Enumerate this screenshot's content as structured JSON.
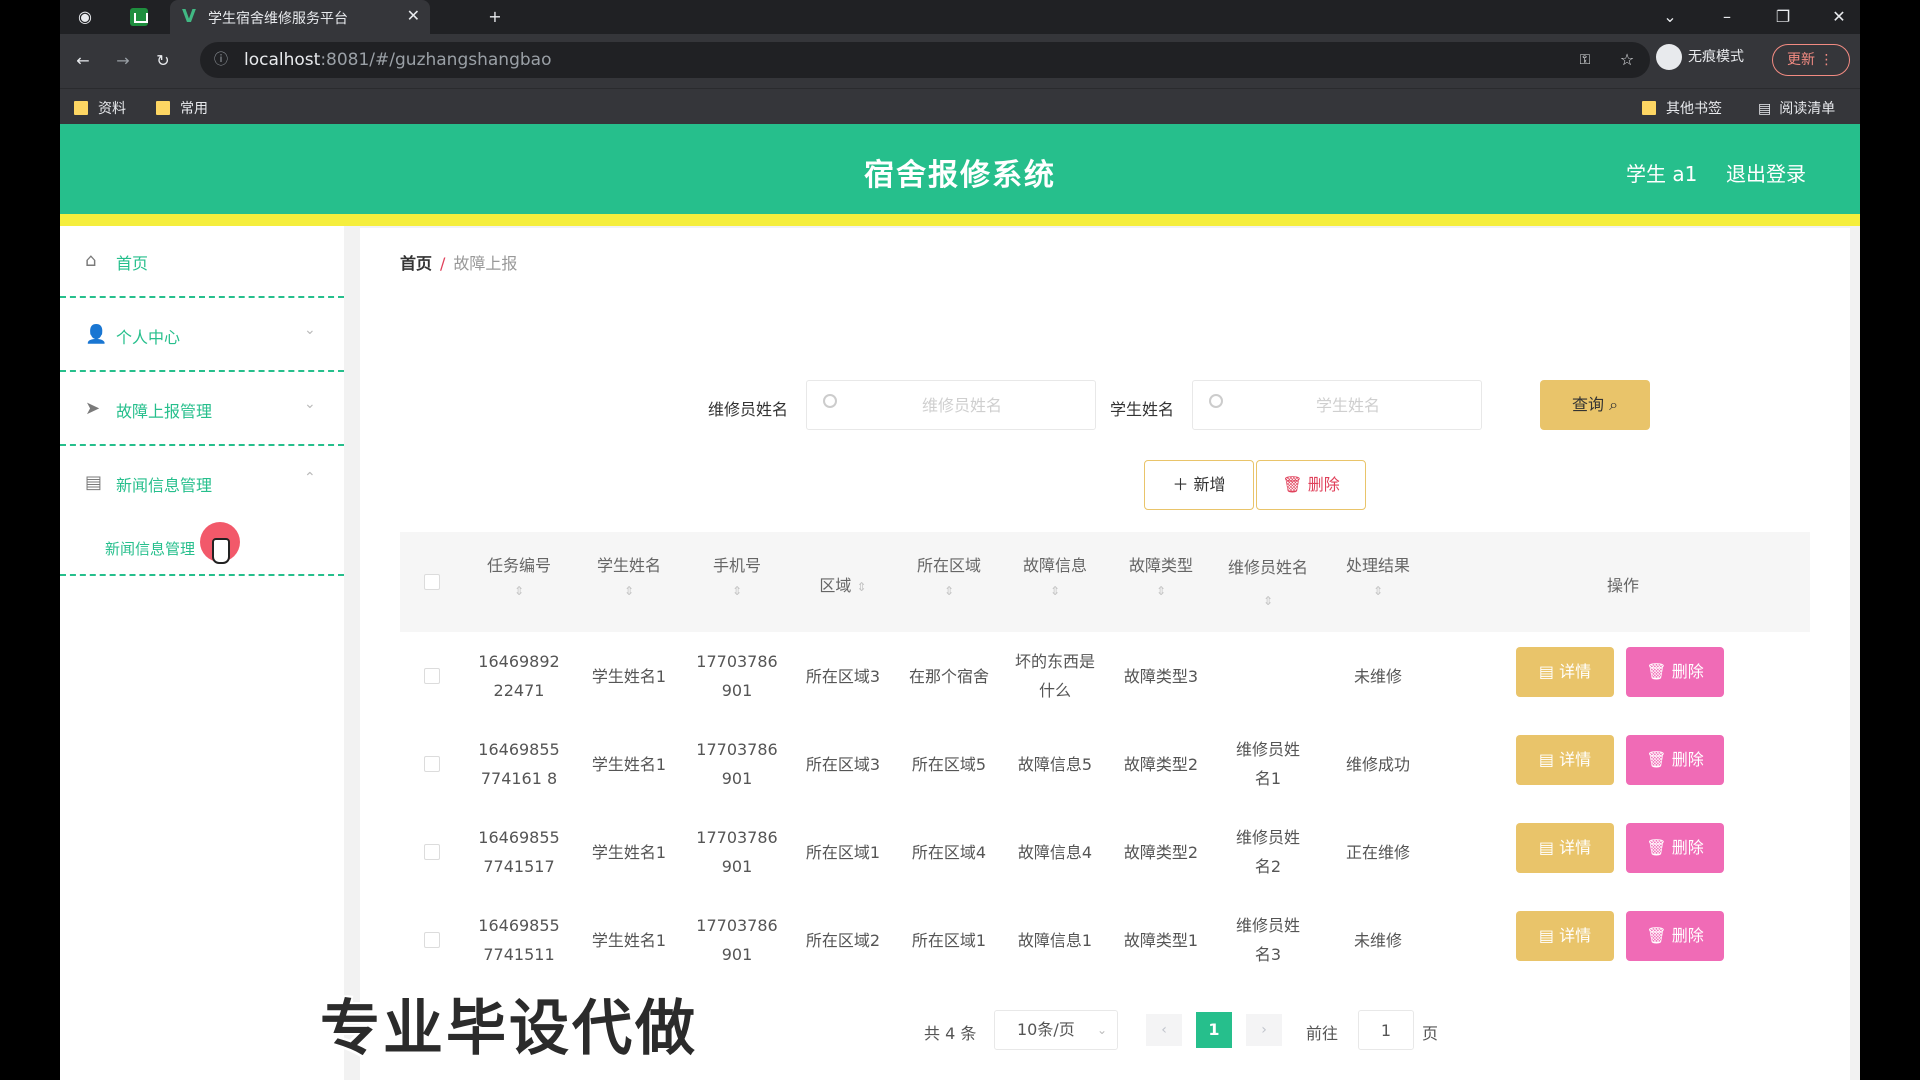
{
  "browser": {
    "tab_title": "学生宿舍维修服务平台",
    "url_host": "localhost",
    "url_rest": ":8081/#/guzhangshangbao",
    "incognito_label": "无痕模式",
    "update_label": "更新",
    "bookmarks": [
      "资料",
      "常用"
    ],
    "bookmarks_right": [
      "其他书签",
      "阅读清单"
    ]
  },
  "header": {
    "title": "宿舍报修系统",
    "user": "学生 a1",
    "logout": "退出登录"
  },
  "sidebar": {
    "items": [
      {
        "label": "首页",
        "icon": "home-icon"
      },
      {
        "label": "个人中心",
        "icon": "user-icon"
      },
      {
        "label": "故障上报管理",
        "icon": "send-icon"
      },
      {
        "label": "新闻信息管理",
        "icon": "news-icon"
      }
    ],
    "submenu": "新闻信息管理"
  },
  "breadcrumb": {
    "home": "首页",
    "separator": "/",
    "current": "故障上报"
  },
  "search": {
    "repairer_label": "维修员姓名",
    "repairer_placeholder": "维修员姓名",
    "student_label": "学生姓名",
    "student_placeholder": "学生姓名",
    "query_label": "查询"
  },
  "actions": {
    "add_label": "新增",
    "delete_label": "删除"
  },
  "table": {
    "headers": [
      "任务编号",
      "学生姓名",
      "手机号",
      "区域",
      "所在区域",
      "故障信息",
      "故障类型",
      "维修员姓名",
      "处理结果",
      "操作"
    ],
    "rows": [
      [
        "1646989222471",
        "学生姓名1",
        "17703786901",
        "所在区域3",
        "在那个宿舍",
        "坏的东西是什么",
        "故障类型3",
        "",
        "未维修"
      ],
      [
        "16469855774161 8",
        "学生姓名1",
        "17703786901",
        "所在区域3",
        "所在区域5",
        "故障信息5",
        "故障类型2",
        "维修员姓名1",
        "维修成功"
      ],
      [
        "164698557741517",
        "学生姓名1",
        "17703786901",
        "所在区域1",
        "所在区域4",
        "故障信息4",
        "故障类型2",
        "维修员姓名2",
        "正在维修"
      ],
      [
        "164698557741511",
        "学生姓名1",
        "17703786901",
        "所在区域2",
        "所在区域1",
        "故障信息1",
        "故障类型1",
        "维修员姓名3",
        "未维修"
      ]
    ],
    "row_detail_label": "详情",
    "row_delete_label": "删除"
  },
  "pagination": {
    "total": "共 4 条",
    "page_size": "10条/页",
    "current_page": "1",
    "goto_label": "前往",
    "goto_value": "1",
    "page_unit": "页"
  },
  "watermark": "专业毕设代做",
  "colors": {
    "brand": "#26bf8c",
    "strip": "#f5ee3d",
    "button_yellow": "#e9c46a",
    "button_pink": "#f06bb6"
  }
}
